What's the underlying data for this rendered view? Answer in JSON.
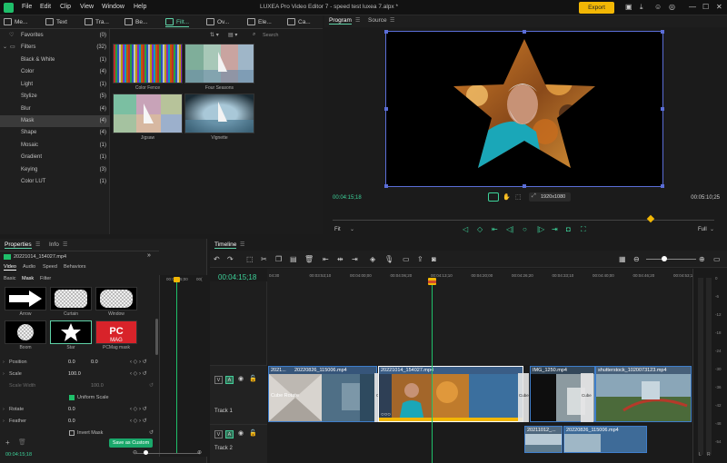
{
  "menubar": {
    "items": [
      "File",
      "Edit",
      "Clip",
      "View",
      "Window",
      "Help"
    ],
    "title": "LUXEA Pro Video Editor 7 - speed test luxea 7.alpx *",
    "export_label": "Export"
  },
  "media_tabs": [
    {
      "label": "Me..."
    },
    {
      "label": "Text"
    },
    {
      "label": "Tra..."
    },
    {
      "label": "Be..."
    },
    {
      "label": "Filt..."
    },
    {
      "label": "Ov..."
    },
    {
      "label": "Ele..."
    },
    {
      "label": "Ca..."
    }
  ],
  "search_placeholder": "Search",
  "categories": {
    "favorites": {
      "label": "Favorites",
      "count": "(0)"
    },
    "filters": {
      "label": "Filters",
      "count": "(32)"
    },
    "items": [
      {
        "label": "Black & White",
        "count": "(1)"
      },
      {
        "label": "Color",
        "count": "(4)"
      },
      {
        "label": "Light",
        "count": "(1)"
      },
      {
        "label": "Stylize",
        "count": "(5)"
      },
      {
        "label": "Blur",
        "count": "(4)"
      },
      {
        "label": "Mask",
        "count": "(4)"
      },
      {
        "label": "Shape",
        "count": "(4)"
      },
      {
        "label": "Mosaic",
        "count": "(1)"
      },
      {
        "label": "Gradient",
        "count": "(1)"
      },
      {
        "label": "Keying",
        "count": "(3)"
      },
      {
        "label": "Color LUT",
        "count": "(1)"
      }
    ]
  },
  "filter_thumbs": [
    {
      "label": "Color Fence"
    },
    {
      "label": "Four Seasons"
    },
    {
      "label": "Jigsaw"
    },
    {
      "label": "Vignette"
    }
  ],
  "preview": {
    "tab_program": "Program",
    "tab_source": "Source",
    "time_current": "00:04:15;18",
    "time_total": "00:05:10;25",
    "resolution": "1920x1080",
    "fit": "Fit",
    "quality": "Full"
  },
  "properties": {
    "tab_properties": "Properties",
    "tab_info": "Info",
    "clip_name": "20221014_154027.mp4",
    "subtabs": [
      "Video",
      "Audio",
      "Speed",
      "Behaviors"
    ],
    "subtabs2": [
      "Basic",
      "Mask",
      "Filter"
    ],
    "masks": [
      {
        "label": "Arrow"
      },
      {
        "label": "Curtain"
      },
      {
        "label": "Window"
      },
      {
        "label": "Boom"
      },
      {
        "label": "Star"
      },
      {
        "label": "PCMag mask"
      }
    ],
    "rows": [
      {
        "label": "Position",
        "v1": "0.0",
        "v2": "0.0"
      },
      {
        "label": "Scale",
        "v1": "100.0",
        "v2": ""
      },
      {
        "label": "Scale Width",
        "v1": "",
        "v2": "100.0"
      },
      {
        "label": "Rotate",
        "v1": "0.0",
        "v2": ""
      },
      {
        "label": "Feather",
        "v1": "0.0",
        "v2": ""
      }
    ],
    "uniform_scale": "Uniform Scale",
    "invert_mask": "Invert Mask",
    "save_custom": "Save as Custom",
    "mini_time": "00:04:15;18",
    "mini_ruler": "00:04:15;00",
    "mini_ruler2": "00("
  },
  "timeline": {
    "title": "Timeline",
    "timecode": "00:04:15;18",
    "ruler": [
      "04:30",
      "00:03:53;10",
      "00:04:00;00",
      "00:04:06;20",
      "00:04:13;10",
      "00:04:20;00",
      "00:04:26;20",
      "00:04:33;10",
      "00:04:40;00",
      "00:04:46;20",
      "00:04:53;10"
    ],
    "track1": "Track 1",
    "track2": "Track 2",
    "clips1": [
      {
        "label": "2021..."
      },
      {
        "label": "20220826_115006.mp4"
      },
      {
        "label": "20221014_154027.mp4"
      },
      {
        "label": "IMG_1250.mp4"
      },
      {
        "label": "shutterstock_1020073123.mp4"
      }
    ],
    "clips2": [
      {
        "label": "20211012_..."
      },
      {
        "label": "20220826_115006.mp4"
      }
    ],
    "transition_labels": [
      "Cube Rotate",
      "Cube",
      "Cube",
      "Cube"
    ]
  },
  "vu_meter": {
    "levels": [
      "0",
      "-6",
      "-12",
      "-18",
      "-24",
      "-30",
      "-36",
      "-42",
      "-48",
      "-54"
    ],
    "lr": [
      "L",
      "R"
    ]
  }
}
